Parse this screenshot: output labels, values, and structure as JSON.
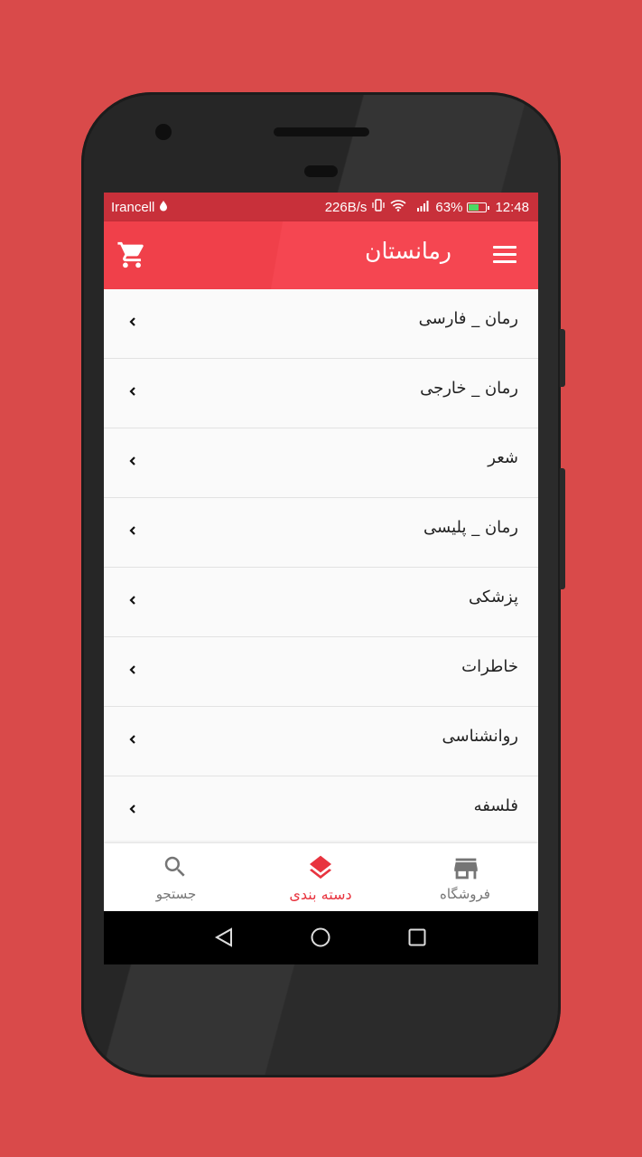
{
  "status_bar": {
    "carrier": "Irancell",
    "speed": "226B/s",
    "battery_percent": "63%",
    "battery_level": 0.63,
    "time": "12:48"
  },
  "app_bar": {
    "title": "رمانستان",
    "menu_icon": "hamburger-menu-icon",
    "cart_icon": "shopping-cart-icon",
    "background": "#f54651"
  },
  "categories": [
    {
      "label": "رمان _ فارسی"
    },
    {
      "label": "رمان _ خارجی"
    },
    {
      "label": "شعر"
    },
    {
      "label": "رمان _ پلیسی"
    },
    {
      "label": "پزشکی"
    },
    {
      "label": "خاطرات"
    },
    {
      "label": "روانشناسی"
    },
    {
      "label": "فلسفه"
    }
  ],
  "bottom_nav": {
    "search": {
      "label": "جستجو",
      "icon": "search-icon"
    },
    "categories": {
      "label": "دسته بندی",
      "icon": "layers-icon",
      "active": true
    },
    "store": {
      "label": "فروشگاه",
      "icon": "store-icon"
    }
  },
  "colors": {
    "accent": "#e8343f",
    "inactive": "#757575",
    "page_background": "#d94a4a"
  }
}
